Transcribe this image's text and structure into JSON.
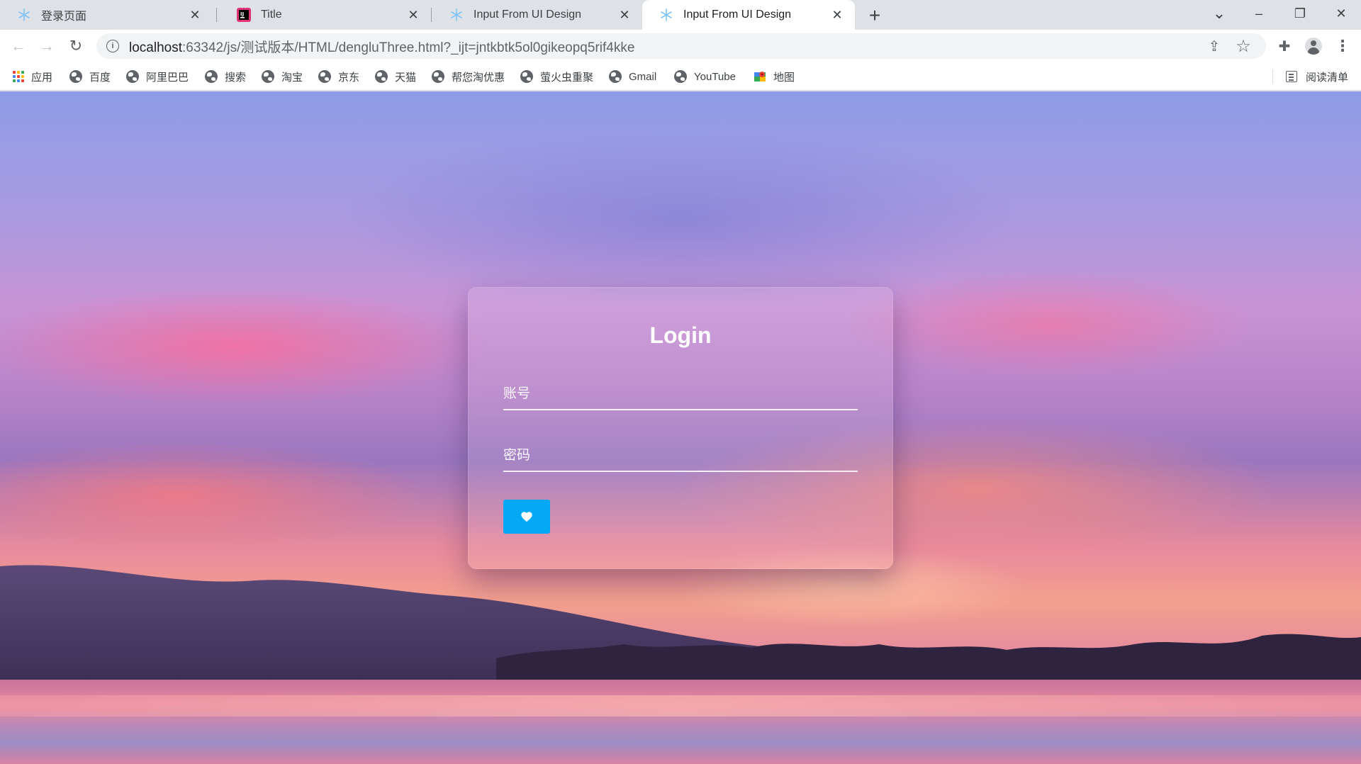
{
  "browser": {
    "tabs": [
      {
        "title": "登录页面",
        "favicon": "snowflake-icon",
        "active": false
      },
      {
        "title": "Title",
        "favicon": "jetbrains-icon",
        "active": false
      },
      {
        "title": "Input From UI Design",
        "favicon": "snowflake-icon",
        "active": false
      },
      {
        "title": "Input From UI Design",
        "favicon": "snowflake-icon",
        "active": true
      }
    ],
    "tab_close_glyph": "✕",
    "new_tab_glyph": "+",
    "window_controls": {
      "minimize": "–",
      "restore": "❐",
      "close": "✕",
      "tab_search": "⌄"
    },
    "nav": {
      "back": "←",
      "forward": "→",
      "reload": "↻"
    },
    "url": {
      "host": "localhost",
      "rest": ":63342/js/测试版本/HTML/dengluThree.html?_ijt=jntkbtk5ol0gikeopq5rif4kke"
    },
    "toolbar_icons": [
      "share-icon",
      "star-icon",
      "extensions-icon",
      "profile-avatar",
      "kebab-menu-icon"
    ],
    "share_glyph": "⇪",
    "star_glyph": "☆",
    "extensions_glyph": "✚",
    "menu_glyph": "⋮",
    "bookmarks": [
      {
        "label": "应用",
        "icon": "apps-grid-icon"
      },
      {
        "label": "百度",
        "icon": "globe-icon"
      },
      {
        "label": "阿里巴巴",
        "icon": "globe-icon"
      },
      {
        "label": "搜索",
        "icon": "globe-icon"
      },
      {
        "label": "淘宝",
        "icon": "globe-icon"
      },
      {
        "label": "京东",
        "icon": "globe-icon"
      },
      {
        "label": "天猫",
        "icon": "globe-icon"
      },
      {
        "label": "帮您淘优惠",
        "icon": "globe-icon"
      },
      {
        "label": "萤火虫重聚",
        "icon": "globe-icon"
      },
      {
        "label": "Gmail",
        "icon": "globe-icon"
      },
      {
        "label": "YouTube",
        "icon": "globe-icon"
      },
      {
        "label": "地图",
        "icon": "maps-icon"
      }
    ],
    "reading_list": "阅读清单"
  },
  "login": {
    "title": "Login",
    "username_placeholder": "账号",
    "password_placeholder": "密码",
    "submit_icon": "heart-icon"
  },
  "colors": {
    "submit_button": "#03a9f4",
    "card_text": "#ffffff",
    "tabstrip_bg": "#dee1e6"
  }
}
